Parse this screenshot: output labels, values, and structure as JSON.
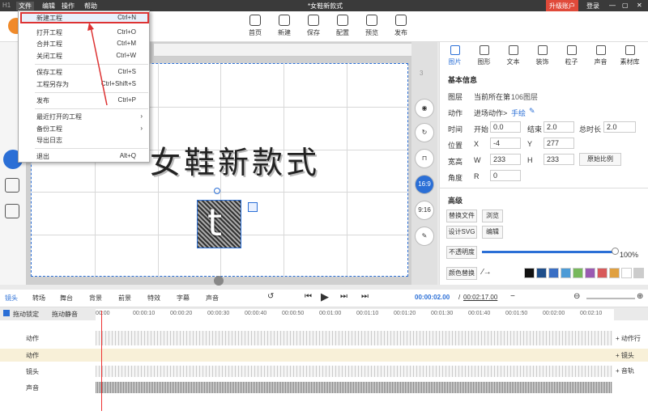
{
  "titlebar": {
    "logo": "H1",
    "menus": [
      "文件",
      "编辑",
      "操作",
      "帮助"
    ],
    "title": "*女鞋新款式",
    "upgrade": "升级账户",
    "login": "登录",
    "min": "—",
    "max": "▢",
    "close": "✕"
  },
  "toolbar": {
    "items": [
      "首页",
      "新建",
      "保存",
      "配置",
      "预览",
      "发布"
    ]
  },
  "file_menu": {
    "items": [
      {
        "label": "新建工程",
        "shortcut": "Ctrl+N"
      },
      {
        "label": "打开工程",
        "shortcut": "Ctrl+O"
      },
      {
        "label": "合并工程",
        "shortcut": "Ctrl+M"
      },
      {
        "label": "关闭工程",
        "shortcut": "Ctrl+W"
      },
      {
        "label": "保存工程",
        "shortcut": "Ctrl+S"
      },
      {
        "label": "工程另存为",
        "shortcut": "Ctrl+Shift+S"
      },
      {
        "label": "发布",
        "shortcut": "Ctrl+P"
      },
      {
        "label": "最近打开的工程",
        "shortcut": "›"
      },
      {
        "label": "备份工程",
        "shortcut": "›"
      },
      {
        "label": "导出日志",
        "shortcut": ""
      },
      {
        "label": "退出",
        "shortcut": "Alt+Q"
      }
    ]
  },
  "canvas": {
    "big_text": "女鞋新款式",
    "sprite_char": "t",
    "ratio1": "16:9",
    "ratio2": "9:16",
    "layer_num": "3"
  },
  "panel": {
    "tabs": [
      "图片",
      "图形",
      "文本",
      "装饰",
      "粒子",
      "声音",
      "素材库"
    ],
    "section1": "基本信息",
    "layer_label": "图层",
    "layer_value": "当前所在第",
    "layer_num": "106图层",
    "action_label": "动作",
    "action_value": "进场动作>",
    "action_link": "手绘",
    "time_label": "时间",
    "start_label": "开始",
    "start": "0.0",
    "end_label": "结束",
    "end": "2.0",
    "total_label": "总时长",
    "total": "2.0",
    "pos_label": "位置",
    "x_label": "X",
    "x": "-4",
    "y_label": "Y",
    "y": "277",
    "size_label": "宽高",
    "w_label": "W",
    "w": "233",
    "h_label": "H",
    "h": "233",
    "ratio_btn": "原始比例",
    "angle_label": "角度",
    "r_label": "R",
    "r": "0",
    "section2": "高级",
    "replace_file": "替换文件",
    "browse": "浏览",
    "svg_design": "设计SVG",
    "edit": "编辑",
    "opacity_label": "不透明度",
    "opacity": "100%",
    "color_replace": "颜色替换",
    "swatches": [
      "#111111",
      "#1f4e8a",
      "#3a6fc4",
      "#4d9bd6",
      "#77b85c",
      "#9a5ab2",
      "#d85a5a",
      "#e0a040",
      "#ffffff",
      "#cccccc"
    ]
  },
  "timeline": {
    "tabs": [
      "镜头",
      "转场",
      "舞台",
      "背景",
      "前景",
      "特效",
      "字幕",
      "声音"
    ],
    "current_time": "00:00:02.00",
    "total_time": "00:02:17.00",
    "ticks": [
      "00:00",
      "00:00:10",
      "00:00:20",
      "00:00:30",
      "00:00:40",
      "00:00:50",
      "00:01:00",
      "00:01:10",
      "00:01:20",
      "00:01:30",
      "00:01:40",
      "00:01:50",
      "00:02:00",
      "00:02:10"
    ],
    "lock_label": "拖动锁定",
    "mute_label": "拖动静音",
    "rows": [
      "动作",
      "动作",
      "镜头",
      "声音"
    ],
    "add_buttons": [
      "+ 动作行",
      "+ 镜头",
      "+ 音轨"
    ]
  }
}
